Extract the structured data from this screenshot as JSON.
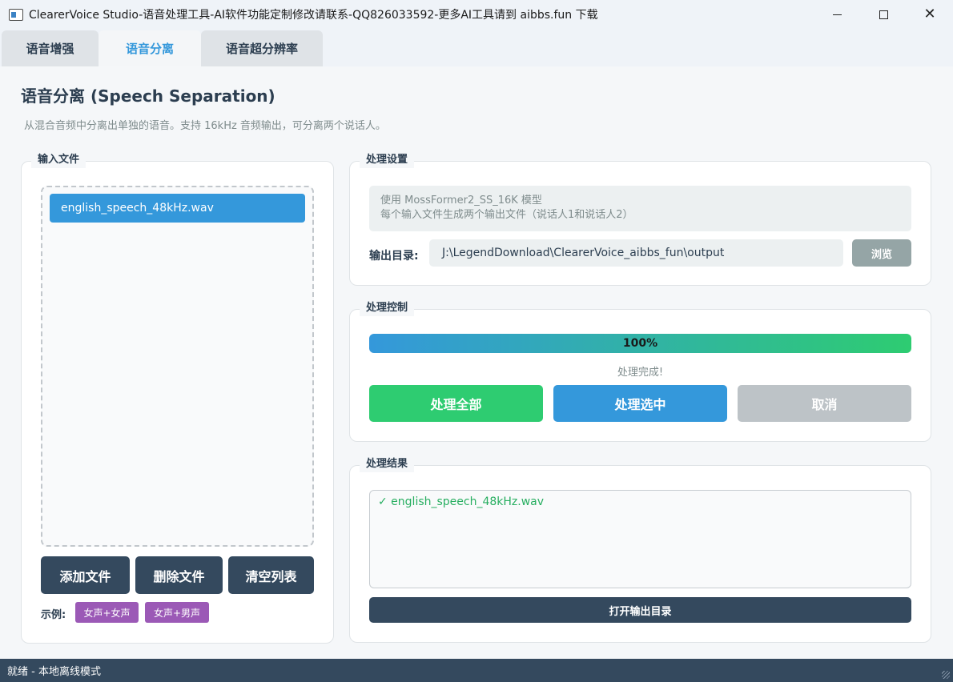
{
  "window": {
    "title": "ClearerVoice Studio-语音处理工具-AI软件功能定制修改请联系-QQ826033592-更多AI工具请到 aibbs.fun 下载"
  },
  "tabs": [
    {
      "label": "语音增强"
    },
    {
      "label": "语音分离"
    },
    {
      "label": "语音超分辨率"
    }
  ],
  "page": {
    "title": "语音分离 (Speech Separation)",
    "description": "从混合音频中分离出单独的语音。支持 16kHz 音频输出，可分离两个说话人。"
  },
  "input_group": {
    "title": "输入文件",
    "files": [
      "english_speech_48kHz.wav"
    ],
    "add_label": "添加文件",
    "remove_label": "删除文件",
    "clear_label": "清空列表",
    "example_label": "示例:",
    "examples": [
      "女声+女声",
      "女声+男声"
    ]
  },
  "settings_group": {
    "title": "处理设置",
    "info_line1": "使用 MossFormer2_SS_16K 模型",
    "info_line2": "每个输入文件生成两个输出文件（说话人1和说话人2）",
    "output_label": "输出目录:",
    "output_dir": "J:\\LegendDownload\\ClearerVoice_aibbs_fun\\output",
    "browse_label": "浏览"
  },
  "control_group": {
    "title": "处理控制",
    "progress_percent": 100,
    "progress_text": "100%",
    "status": "处理完成!",
    "process_all_label": "处理全部",
    "process_selected_label": "处理选中",
    "cancel_label": "取消"
  },
  "results_group": {
    "title": "处理结果",
    "results": [
      "✓ english_speech_48kHz.wav"
    ],
    "open_dir_label": "打开输出目录"
  },
  "statusbar": {
    "text": "就绪 - 本地离线模式"
  },
  "colors": {
    "primary": "#3498db",
    "success": "#2ecc71",
    "dark": "#34495e",
    "disabled": "#bdc3c7",
    "tag": "#9b59b6"
  }
}
